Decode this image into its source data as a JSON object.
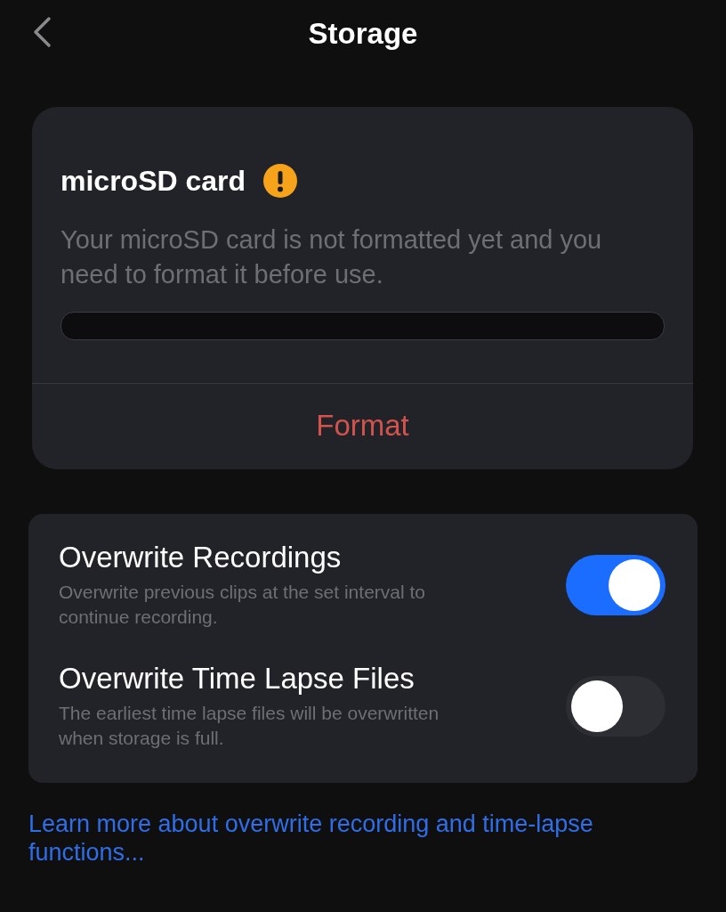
{
  "header": {
    "title": "Storage"
  },
  "sd_card": {
    "title": "microSD card",
    "warning": true,
    "message": "Your microSD card is not formatted yet and you need to format it before use.",
    "usage_bar": {
      "level": 0
    },
    "action": "Format"
  },
  "settings": [
    {
      "label": "Overwrite Recordings",
      "description": "Overwrite previous clips at the set interval to continue recording.",
      "on": true
    },
    {
      "label": "Overwrite Time Lapse Files",
      "description": "The earliest time lapse files will be overwritten when storage is full.",
      "on": false
    }
  ],
  "link": "Learn more about overwrite recording and time-lapse functions..."
}
